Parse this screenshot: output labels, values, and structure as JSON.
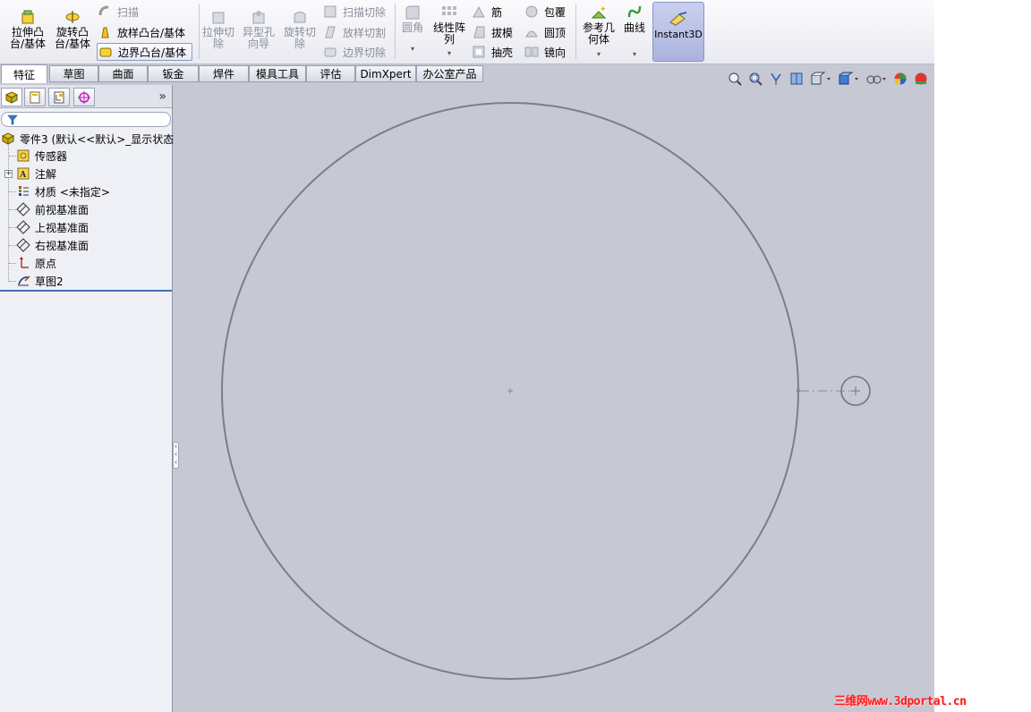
{
  "ribbon": {
    "extrude_boss": "拉伸凸\n台/基体",
    "revolve_boss": "旋转凸\n台/基体",
    "sweep": "扫描",
    "loft": "放样凸台/基体",
    "boundary": "边界凸台/基体",
    "extrude_cut": "拉伸切\n除",
    "hole_wizard": "异型孔\n向导",
    "revolve_cut": "旋转切\n除",
    "sweep_cut": "扫描切除",
    "loft_cut": "放样切割",
    "boundary_cut": "边界切除",
    "fillet": "圆角",
    "linear_pattern": "线性阵\n列",
    "rib": "筋",
    "draft": "拔模",
    "shell": "抽壳",
    "wrap": "包覆",
    "dome": "圆顶",
    "mirror": "镜向",
    "ref_geometry": "参考几\n何体",
    "curves": "曲线",
    "instant3d": "Instant3D"
  },
  "tabs": [
    "特征",
    "草图",
    "曲面",
    "钣金",
    "焊件",
    "模具工具",
    "评估",
    "DimXpert",
    "办公室产品"
  ],
  "active_tab": "特征",
  "tree": {
    "root": "零件3  (默认<<默认>_显示状态",
    "items": [
      {
        "label": "传感器",
        "icon": "sensor-icon"
      },
      {
        "label": "注解",
        "icon": "annotation-icon"
      },
      {
        "label": "材质 <未指定>",
        "icon": "material-icon"
      },
      {
        "label": "前视基准面",
        "icon": "plane-icon"
      },
      {
        "label": "上视基准面",
        "icon": "plane-icon"
      },
      {
        "label": "右视基准面",
        "icon": "plane-icon"
      },
      {
        "label": "原点",
        "icon": "origin-icon"
      },
      {
        "label": "草图2",
        "icon": "sketch-icon"
      }
    ]
  },
  "panel": {
    "more": "»"
  },
  "watermark": "三维网www.3dportal.cn",
  "colors": {
    "viewport": "#c6c9d4",
    "sketch_line": "#808080",
    "instant3d_bg": "#b4bce4",
    "watermark": "#ff1c1c"
  }
}
